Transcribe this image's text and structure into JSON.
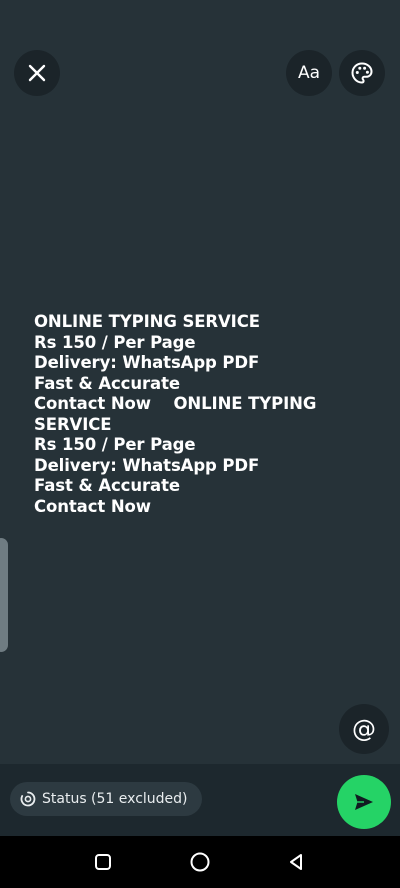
{
  "toolbar": {
    "close_icon": "close-icon",
    "font_label": "Aa",
    "palette_icon": "palette-icon"
  },
  "status": {
    "text": "ONLINE TYPING SERVICE\nRs 150 / Per Page\nDelivery: WhatsApp PDF\nFast & Accurate\nContact Now    ONLINE TYPING SERVICE\nRs 150 / Per Page\nDelivery: WhatsApp PDF\nFast & Accurate\nContact Now",
    "background_color": "#263238",
    "text_color": "#ffffff"
  },
  "mention": {
    "label": "@"
  },
  "footer": {
    "audience_label": "Status (51 excluded)",
    "send_color": "#25d366"
  },
  "nav": {
    "recent_icon": "recent-apps-icon",
    "home_icon": "home-icon",
    "back_icon": "back-icon"
  }
}
